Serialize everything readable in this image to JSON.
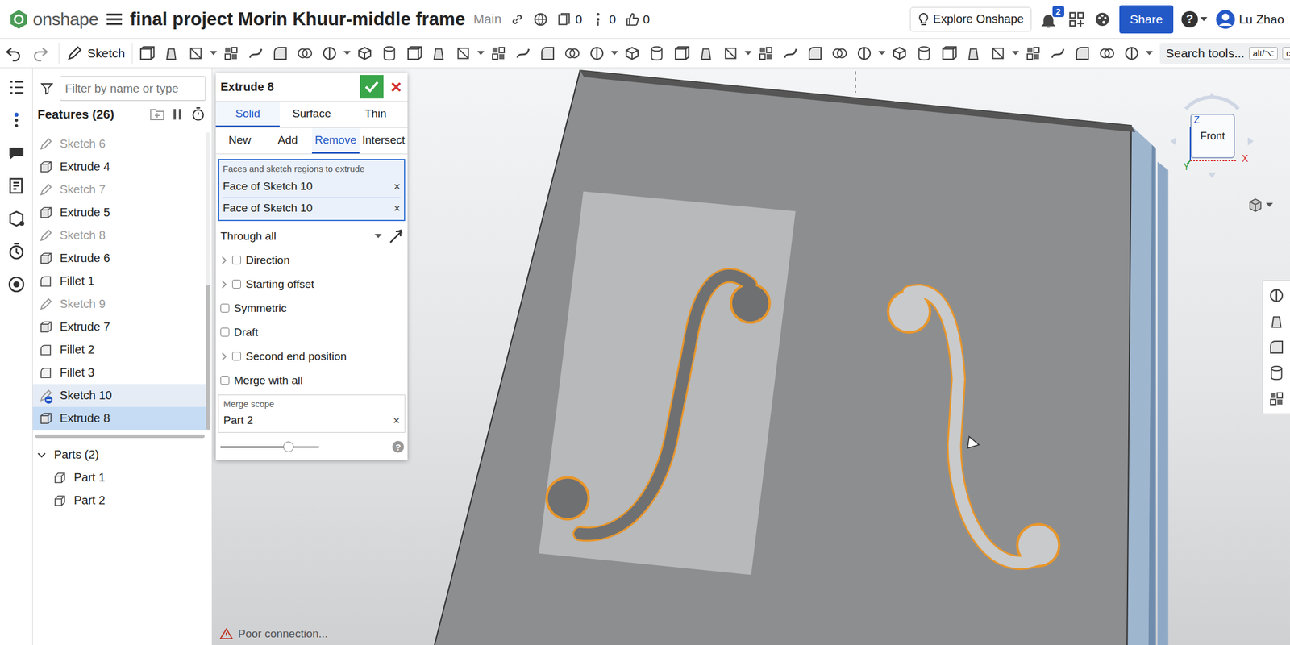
{
  "app": {
    "logo": "onshape",
    "title": "final project Morin Khuur-middle frame",
    "branch": "Main",
    "counts": [
      {
        "value": "0"
      },
      {
        "value": "0"
      },
      {
        "value": "0"
      }
    ],
    "explore": "Explore Onshape",
    "notifications": "2",
    "share": "Share",
    "help": "?",
    "user": "Lu Zhao"
  },
  "toolbar": {
    "sketch": "Sketch",
    "search": "Search tools...",
    "keys": [
      "alt/⌥",
      "c"
    ]
  },
  "features": {
    "filter_placeholder": "Filter by name or type",
    "title": "Features (26)",
    "items": [
      {
        "label": "Sketch 6",
        "kind": "sketch",
        "selected": false,
        "highlighted": false,
        "in_use": false
      },
      {
        "label": "Extrude 4",
        "kind": "extrude",
        "selected": false,
        "highlighted": false,
        "in_use": false
      },
      {
        "label": "Sketch 7",
        "kind": "sketch",
        "selected": false,
        "highlighted": false,
        "in_use": false
      },
      {
        "label": "Extrude 5",
        "kind": "extrude",
        "selected": false,
        "highlighted": false,
        "in_use": false
      },
      {
        "label": "Sketch 8",
        "kind": "sketch",
        "selected": false,
        "highlighted": false,
        "in_use": false
      },
      {
        "label": "Extrude 6",
        "kind": "extrude",
        "selected": false,
        "highlighted": false,
        "in_use": false
      },
      {
        "label": "Fillet 1",
        "kind": "fillet",
        "selected": false,
        "highlighted": false,
        "in_use": false
      },
      {
        "label": "Sketch 9",
        "kind": "sketch",
        "selected": false,
        "highlighted": false,
        "in_use": false
      },
      {
        "label": "Extrude 7",
        "kind": "extrude",
        "selected": false,
        "highlighted": false,
        "in_use": false
      },
      {
        "label": "Fillet 2",
        "kind": "fillet",
        "selected": false,
        "highlighted": false,
        "in_use": false
      },
      {
        "label": "Fillet 3",
        "kind": "fillet",
        "selected": false,
        "highlighted": false,
        "in_use": false
      },
      {
        "label": "Sketch 10",
        "kind": "sketch",
        "selected": false,
        "highlighted": true,
        "in_use": true
      },
      {
        "label": "Extrude 8",
        "kind": "extrude",
        "selected": true,
        "highlighted": false,
        "in_use": false
      }
    ],
    "parts_title": "Parts (2)",
    "parts_expanded": true,
    "parts": [
      "Part 1",
      "Part 2"
    ]
  },
  "dialog": {
    "title": "Extrude 8",
    "close": "×",
    "body_types": [
      {
        "label": "Solid",
        "selected": true
      },
      {
        "label": "Surface",
        "selected": false
      },
      {
        "label": "Thin",
        "selected": false
      }
    ],
    "operations": [
      {
        "label": "New",
        "selected": false
      },
      {
        "label": "Add",
        "selected": false
      },
      {
        "label": "Remove",
        "selected": true
      },
      {
        "label": "Intersect",
        "selected": false
      }
    ],
    "selection": {
      "label": "Faces and sketch regions to extrude",
      "items": [
        {
          "label": "Face of Sketch 10",
          "remove": "×"
        },
        {
          "label": "Face of Sketch 10",
          "remove": "×"
        }
      ]
    },
    "end_type": "Through all",
    "options": [
      {
        "label": "Direction",
        "checked": false,
        "expandable": true
      },
      {
        "label": "Starting offset",
        "checked": false,
        "expandable": true
      },
      {
        "label": "Symmetric",
        "checked": false,
        "expandable": false
      },
      {
        "label": "Draft",
        "checked": false,
        "expandable": false
      },
      {
        "label": "Second end position",
        "checked": false,
        "expandable": true
      },
      {
        "label": "Merge with all",
        "checked": false,
        "expandable": false
      }
    ],
    "merge_scope": {
      "label": "Merge scope",
      "value": "Part 2",
      "remove": "×"
    },
    "slider": {
      "level": 0.69
    },
    "help": "?"
  },
  "view_cube": {
    "face": "Front",
    "axes": [
      "Z",
      "X",
      "Y"
    ]
  },
  "status": "Poor connection..."
}
